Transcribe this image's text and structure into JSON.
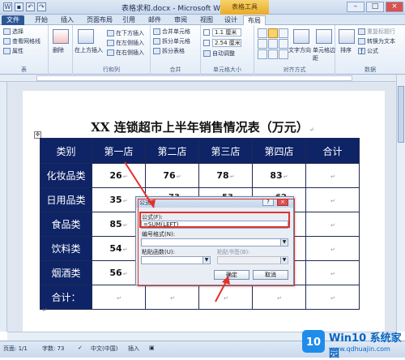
{
  "window": {
    "title": "表格求和.docx - Microsoft Word",
    "context_tab": "表格工具",
    "min": "–",
    "max": "□",
    "close": "×"
  },
  "tabs": [
    "文件",
    "开始",
    "插入",
    "页面布局",
    "引用",
    "邮件",
    "审阅",
    "视图",
    "设计",
    "布局"
  ],
  "ribbon": {
    "table": {
      "select": "选择",
      "gridlines": "查看网格线",
      "properties": "属性",
      "caption": "表"
    },
    "delete": {
      "label": "删除"
    },
    "rowscols": {
      "above": "在上方插入",
      "below": "在下方插入",
      "left": "在左侧插入",
      "right": "在右侧插入",
      "caption": "行和列"
    },
    "merge": {
      "merge": "合并单元格",
      "split_cells": "拆分单元格",
      "split_table": "拆分表格",
      "caption": "合并"
    },
    "cellsize": {
      "height": "1.1 厘米",
      "width": "2.54 厘米",
      "autofit": "自动调整",
      "caption": "单元格大小"
    },
    "alignment": {
      "direction": "文字方向",
      "margins": "单元格边距",
      "caption": "对齐方式"
    },
    "data": {
      "sort": "排序",
      "repeat": "重复标题行",
      "convert": "转换为文本",
      "formula": "公式",
      "caption": "数据"
    }
  },
  "document": {
    "title": "XX 连锁超市上半年销售情况表（万元）",
    "headers": [
      "类别",
      "第一店",
      "第二店",
      "第三店",
      "第四店",
      "合计"
    ],
    "rows": [
      {
        "cat": "化妆品类",
        "vals": [
          "26",
          "76",
          "78",
          "83",
          ""
        ]
      },
      {
        "cat": "日用品类",
        "vals": [
          "35",
          "",
          "",
          "",
          ""
        ]
      },
      {
        "cat": "食品类",
        "vals": [
          "85",
          "",
          "",
          "",
          ""
        ]
      },
      {
        "cat": "饮料类",
        "vals": [
          "54",
          "",
          "",
          "",
          ""
        ]
      },
      {
        "cat": "烟酒类",
        "vals": [
          "56",
          "",
          "",
          "",
          ""
        ]
      },
      {
        "cat": "合计：",
        "vals": [
          "",
          "",
          "",
          "",
          ""
        ]
      }
    ],
    "partial": [
      "73",
      "53",
      "62"
    ]
  },
  "dialog": {
    "title": "公式",
    "help": "?",
    "close": "×",
    "formula_label": "公式(F):",
    "formula_value": "=SUM(LEFT)",
    "format_label": "编号格式(N):",
    "paste_func_label": "粘贴函数(U):",
    "paste_bookmark_label": "粘贴书签(B):",
    "ok": "确定",
    "cancel": "取消"
  },
  "status": {
    "page": "页面: 1/1",
    "words": "字数: 73",
    "lang": "中文(中国)",
    "mode": "插入"
  },
  "watermark": {
    "brand": "Win10 系统家园",
    "url": "www.qdhuajin.com",
    "logo": "10"
  },
  "colors": {
    "header_bg": "#0e2466",
    "highlight": "#e0322b"
  }
}
